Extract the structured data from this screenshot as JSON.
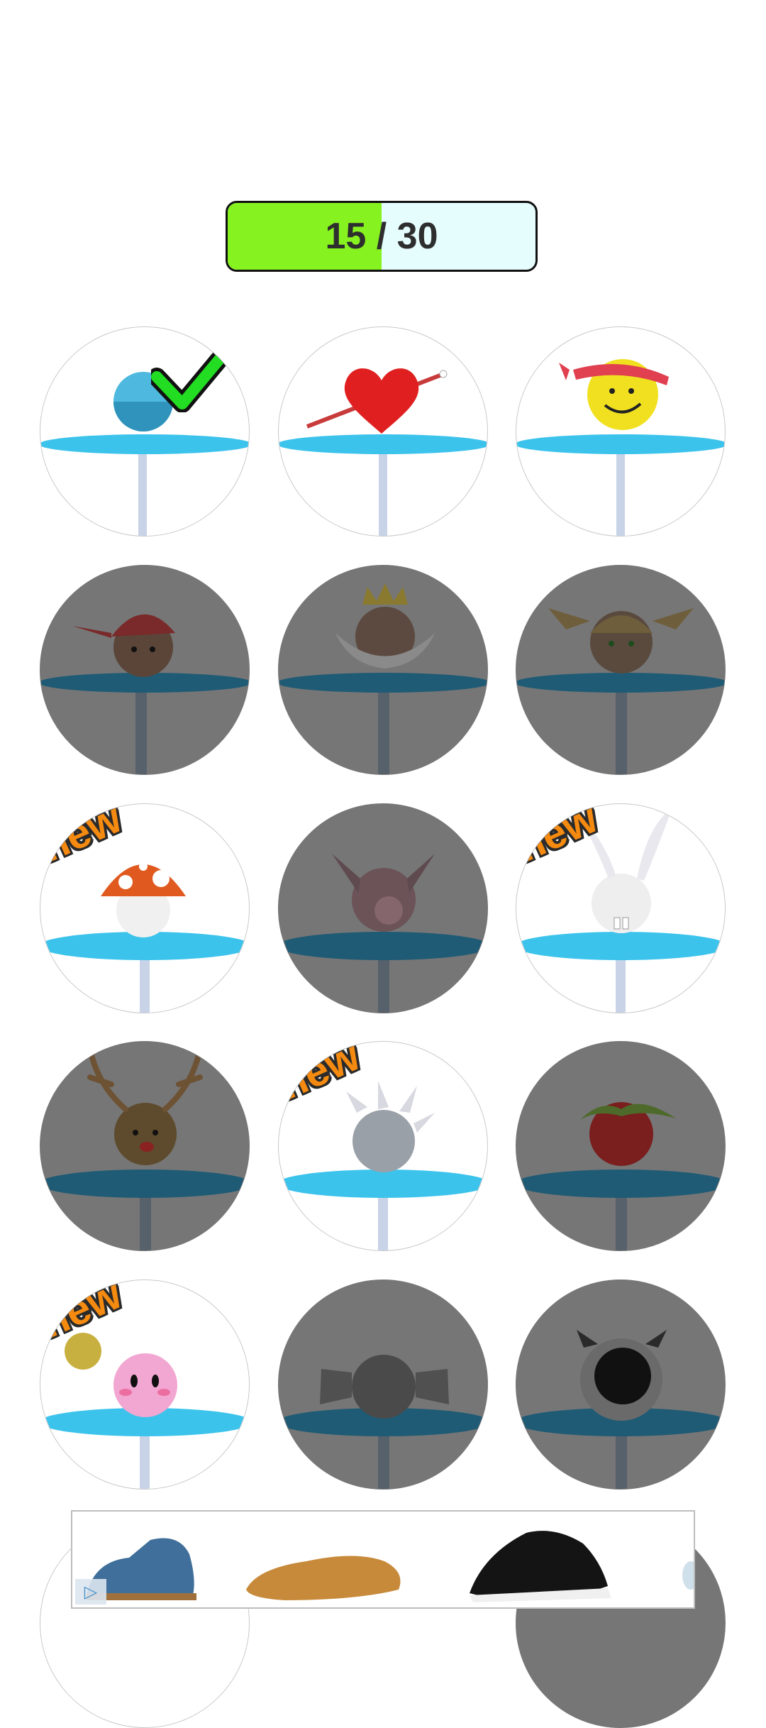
{
  "progress": {
    "current": "15",
    "total": "30",
    "label": "15 / 30",
    "fraction": 0.5,
    "fill_color": "#86f320",
    "track_color": "#e6fdfd"
  },
  "badge": {
    "new_label": "new"
  },
  "colors": {
    "locked_bg": "#767676",
    "table_top": "#3cc3ec",
    "pole": "#c8d3e8",
    "check": "#22dd22"
  },
  "grid": {
    "items": [
      {
        "name": "blue-ball",
        "locked": false,
        "selected": true,
        "is_new": false
      },
      {
        "name": "heart-arrow",
        "locked": false,
        "selected": false,
        "is_new": false
      },
      {
        "name": "smiley-headband",
        "locked": false,
        "selected": false,
        "is_new": false
      },
      {
        "name": "cap-ball",
        "locked": true,
        "selected": false,
        "is_new": false
      },
      {
        "name": "crown-beard-ball",
        "locked": true,
        "selected": false,
        "is_new": false
      },
      {
        "name": "pigtails-ball",
        "locked": true,
        "selected": false,
        "is_new": false
      },
      {
        "name": "mushroom",
        "locked": false,
        "selected": false,
        "is_new": true
      },
      {
        "name": "pig",
        "locked": true,
        "selected": false,
        "is_new": false
      },
      {
        "name": "bunny",
        "locked": false,
        "selected": false,
        "is_new": true
      },
      {
        "name": "reindeer",
        "locked": true,
        "selected": false,
        "is_new": false
      },
      {
        "name": "spiky-ball",
        "locked": false,
        "selected": false,
        "is_new": true
      },
      {
        "name": "tomato",
        "locked": true,
        "selected": false,
        "is_new": false
      },
      {
        "name": "pink-ball",
        "locked": false,
        "selected": false,
        "is_new": true
      },
      {
        "name": "winged-ball",
        "locked": true,
        "selected": false,
        "is_new": false
      },
      {
        "name": "sheep",
        "locked": true,
        "selected": false,
        "is_new": false
      }
    ]
  },
  "ad": {
    "products": [
      "blue-suede-shoe",
      "tan-loafer",
      "black-sneaker"
    ],
    "info_icon": "adchoices-icon"
  }
}
